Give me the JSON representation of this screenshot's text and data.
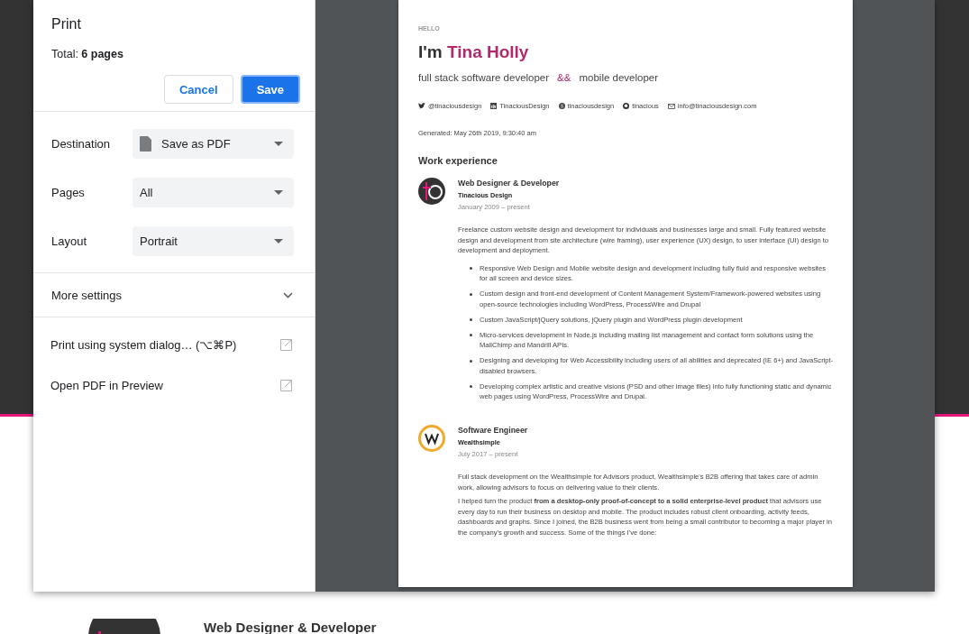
{
  "dialog": {
    "title": "Print",
    "total": "Total: **6 pages**",
    "buttons": [
      {
        "label": "Cancel",
        "kind": "secondary"
      },
      {
        "label": "Save",
        "kind": "primary"
      }
    ],
    "settings": [
      {
        "label": "Destination",
        "value": "Save as PDF",
        "kind": "file"
      },
      {
        "label": "Pages",
        "value": "All",
        "kind": "plain"
      },
      {
        "label": "Layout",
        "value": "Portrait",
        "kind": "plain"
      }
    ],
    "more_settings": {
      "label": "More settings",
      "expanded": false
    },
    "links": [
      {
        "label": "Print using system dialog… (⌥⌘P)"
      },
      {
        "label": "Open PDF in Preview"
      }
    ]
  },
  "preview": {
    "eyebrow": "HELLO",
    "greeting": "I'm",
    "name": "Tina Holly",
    "roles": [
      "full stack software developer",
      "&&",
      "mobile developer"
    ],
    "socials": [
      {
        "kind": "twitter",
        "label": "@tinaciousdesign"
      },
      {
        "kind": "linkedin",
        "label": "TinaciousDesign"
      },
      {
        "kind": "skype",
        "label": "tinaciousdesign"
      },
      {
        "kind": "github",
        "label": "tinacious"
      },
      {
        "kind": "email",
        "label": "info@tinaciousdesign.com"
      }
    ],
    "generated": "Generated: May 26th 2019, 9:30:40 am",
    "section_title": "Work experience",
    "jobs": [
      {
        "kind": "monogram",
        "title": "Web Designer & Developer",
        "company": "Tinacious Design",
        "dates": "January 2009 – present",
        "paragraphs": [
          "Freelance custom website design and development for individuals and businesses large and small. Fully featured website design and development from site architecture (wire framing), user experience (UX) design, to user interface (UI) design to development and deployment."
        ],
        "bullets": [
          "Responsive Web Design and Mobile website design and development including fully fluid and responsive websites for all screen and device sizes.",
          "Custom design and front-end development of Content Management System/Framework-powered websites using open-source technologies including WordPress, ProcessWire and Drupal",
          "Custom JavaScript/jQuery solutions, jQuery plugin and WordPress plugin development",
          "Micro-services development in Node.js including mailing list management and contact form solutions using the MailChimp and Mandrill APIs.",
          "Designing and developing for Web Accessibility including users of all abilities and deprecated (IE 6+) and JavaScript-disabled browsers.",
          "Developing complex artistic and creative visions (PSD and other image files) into fully functioning static and dynamic web pages using WordPress, ProcessWire and Drupal."
        ]
      },
      {
        "kind": "ring",
        "title": "Software Engineer",
        "company": "Wealthsimple",
        "dates": "July 2017 – present",
        "paragraphs": [
          "Full stack development on the Wealthsimple for Advisors product, Wealthsimple's B2B offering that takes care of admin work, allowing advisors to focus on delivering value to their clients.",
          "I helped turn the product **from a desktop-only proof-of-concept to a solid enterprise-level product** that advisors use every day to run their business on desktop and mobile. The product includes robust client onboarding, activity feeds, dashboards and graphs. Since I joined, the B2B business went from being a small contributor to becoming a major player in the company's growth and success. Some of the things I've done:"
        ]
      }
    ]
  },
  "background": {
    "heading": "Web Designer & Developer"
  }
}
